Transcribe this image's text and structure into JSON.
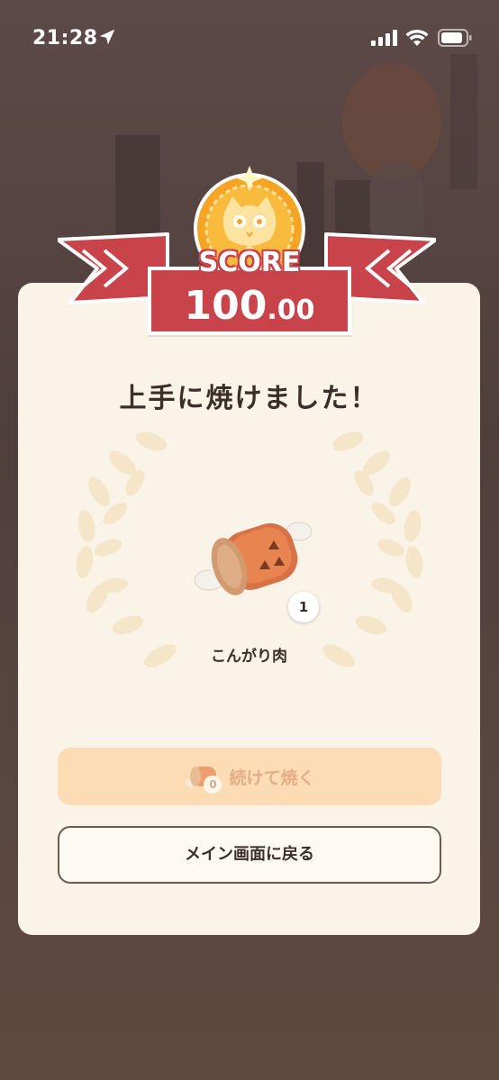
{
  "status_bar": {
    "time": "21:28"
  },
  "result": {
    "score_label": "SCORE",
    "score_int": "100",
    "score_dec": ".00",
    "title": "上手に焼けました！",
    "item": {
      "name": "こんがり肉",
      "quantity": "1"
    }
  },
  "actions": {
    "continue_label": "続けて焼く",
    "continue_cost_count": "0",
    "continue_enabled": false,
    "main_label": "メイン画面に戻る"
  },
  "colors": {
    "ribbon": "#c8434a",
    "card": "#faf3e8",
    "continue_button": "#fcdcb4",
    "medal": "#f6a424"
  },
  "icons": [
    "location-arrow-icon",
    "signal-icon",
    "wifi-icon",
    "battery-icon",
    "cat-medal-icon",
    "meat-icon",
    "laurel-wreath-icon"
  ]
}
